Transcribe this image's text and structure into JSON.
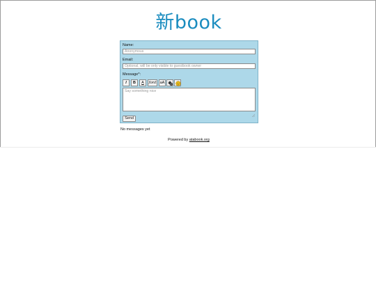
{
  "logo": {
    "text": "新book",
    "color": "#1a8cbf"
  },
  "form": {
    "background": "#add8e9",
    "name_label": "Name:",
    "name_placeholder": "Anonymous",
    "email_label": "Email:",
    "email_placeholder": "Optional, will be only visible to guestbook owner",
    "message_label": "Message*:",
    "toolbar": {
      "italic": "I",
      "bold": "B",
      "underline": "A",
      "font": "font",
      "size": "aA",
      "image_icon": "image-icon",
      "smiley_icon": "smiley-icon"
    },
    "message_placeholder": "Say something nice",
    "send_label": "Send"
  },
  "messages": {
    "empty_text": "No messages yet"
  },
  "footer": {
    "powered_prefix": "Powered by",
    "link_text": "atabook.org"
  }
}
